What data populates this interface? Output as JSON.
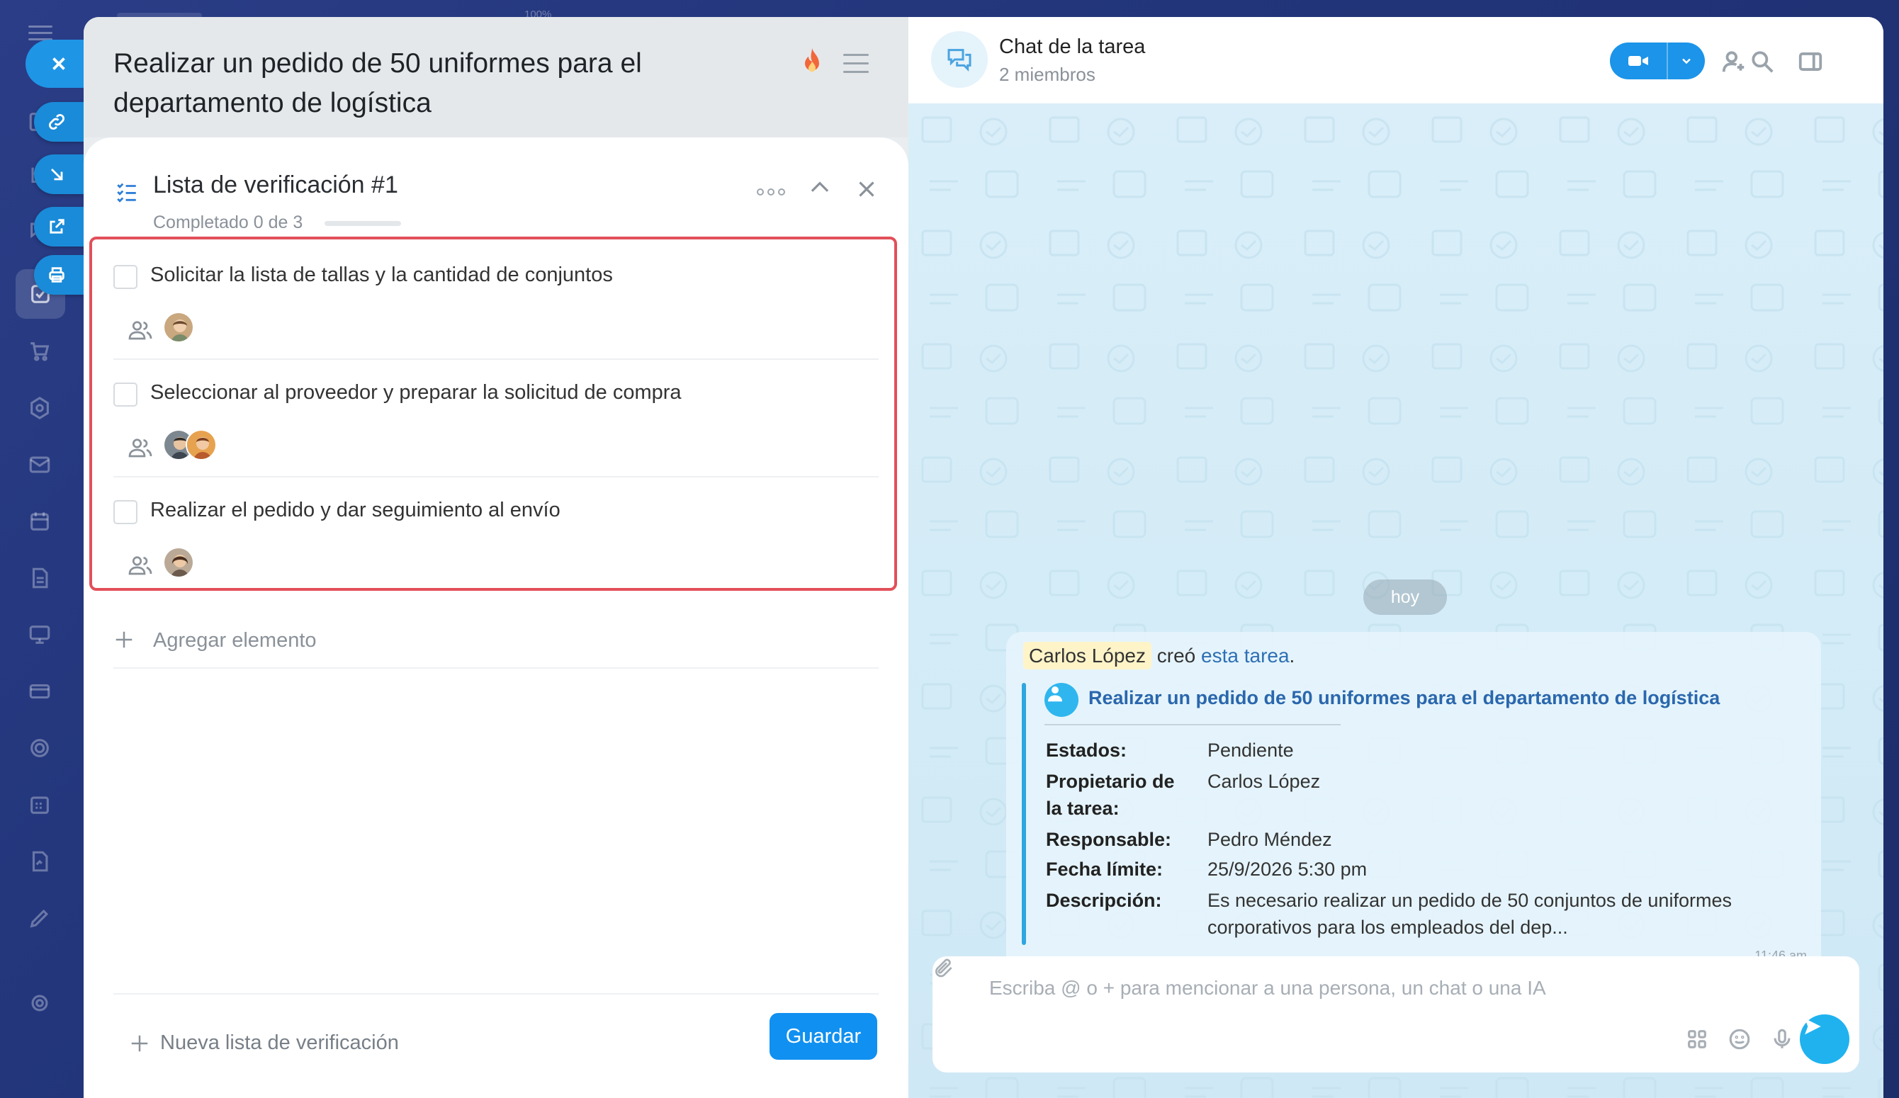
{
  "topbar": {
    "zoom": "100%"
  },
  "task": {
    "title": "Realizar un pedido de 50 uniformes para el departamento de logística"
  },
  "checklist": {
    "title": "Lista de verificación #1",
    "progress_text": "Completado 0 de 3",
    "progress": 0,
    "items": [
      {
        "text": "Solicitar la lista de tallas y la cantidad de conjuntos",
        "checked": false,
        "assignees": 1
      },
      {
        "text": "Seleccionar al proveedor y preparar la solicitud de compra",
        "checked": false,
        "assignees": 2
      },
      {
        "text": "Realizar el pedido y dar seguimiento al envío",
        "checked": false,
        "assignees": 1
      }
    ],
    "add_item_label": "Agregar elemento",
    "new_list_label": "Nueva lista de verificación",
    "save_label": "Guardar"
  },
  "chat": {
    "title": "Chat de la tarea",
    "members": "2 miembros",
    "day_label": "hoy",
    "message": {
      "author": "Carlos López",
      "verb": "creó",
      "link_text": "esta tarea",
      "period": ".",
      "task_link": "Realizar un pedido de 50 uniformes para el departamento de logística",
      "fields": [
        {
          "label": "Estados:",
          "value": "Pendiente"
        },
        {
          "label": "Propietario de la tarea:",
          "value": "Carlos López"
        },
        {
          "label": "Responsable:",
          "value": "Pedro Méndez"
        },
        {
          "label": "Fecha límite:",
          "value": "25/9/2026 5:30 pm"
        },
        {
          "label": "Descripción:",
          "value": "Es necesario realizar un pedido de 50 conjuntos de uniformes corporativos para los empleados del dep..."
        }
      ],
      "time": "11:46 am"
    },
    "composer_placeholder": "Escriba @ o + para mencionar a una persona, un chat o una IA"
  },
  "colors": {
    "accent": "#1090f0",
    "highlight_border": "#e2505a",
    "chat_bg": "#d5edf7",
    "progress_fill": "#2fc6f6"
  }
}
